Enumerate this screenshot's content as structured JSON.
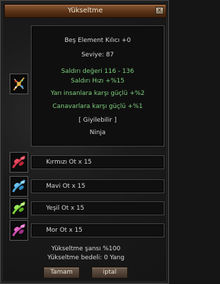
{
  "window": {
    "title": "Yükseltme",
    "close_label": "x"
  },
  "item": {
    "name": "Beş Element Kılıcı +0",
    "level": "Seviye: 87",
    "attack": "Saldırı değeri 116 - 136",
    "attack_speed": "Saldırı Hızı +%15",
    "bonus_half_human": "Yarı insanlara karşı güçlü +%2",
    "bonus_monsters": "Canavarlara karşı güçlü +%1",
    "wearable": "[ Giyilebilir ]",
    "class": "Ninja",
    "icon": "sword-icon"
  },
  "materials": [
    {
      "label": "Kırmızı Ot x 15",
      "icon": "red-herb-icon",
      "color": "#d8344a"
    },
    {
      "label": "Mavi Ot x 15",
      "icon": "blue-herb-icon",
      "color": "#4aa6d8"
    },
    {
      "label": "Yeşil Ot x 15",
      "icon": "green-herb-icon",
      "color": "#7ad23a"
    },
    {
      "label": "Mor Ot x 15",
      "icon": "purple-herb-icon",
      "color": "#c84aa8"
    }
  ],
  "upgrade_chance": "Yükseltme şansı %100",
  "upgrade_cost": "Yükseltme bedeli: 0 Yang",
  "buttons": {
    "ok": "Tamam",
    "cancel": "iptal"
  }
}
